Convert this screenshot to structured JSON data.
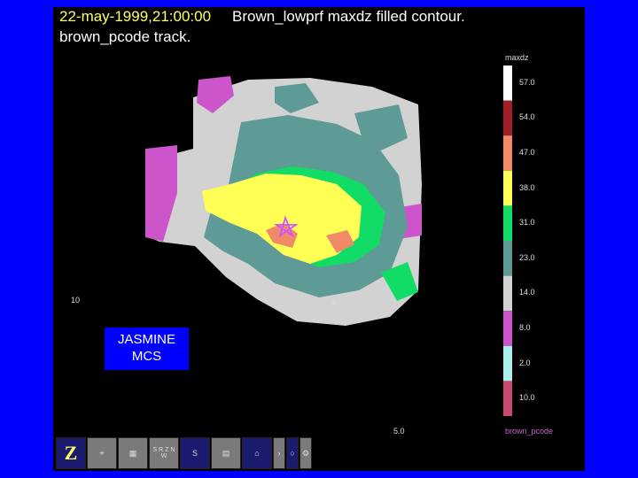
{
  "title": {
    "date": "22-may-1999,21:00:00",
    "main": "Brown_lowprf maxdz filled contour.",
    "sub": "brown_pcode track."
  },
  "axis": {
    "left_label": "10",
    "bottom_label": "5.0",
    "cross": "x"
  },
  "colorbar": {
    "title": "maxdz",
    "labels": [
      "57.0",
      "54.0",
      "47.0",
      "38.0",
      "31.0",
      "23.0",
      "14.0",
      "8.0",
      "2.0",
      "10.0"
    ],
    "colors": [
      "#ffffff",
      "#a0202a",
      "#f08a68",
      "#ffff55",
      "#11dd66",
      "#5e9a96",
      "#d2d2d2",
      "#cc55cc",
      "#aaeeee",
      "#c84a70"
    ],
    "footer": "brown_pcode"
  },
  "annotation": {
    "line1": "JASMINE",
    "line2": "MCS"
  },
  "toolbar": {
    "items": [
      "z-logo-icon",
      "radar-site-icon",
      "grid-icon",
      "s-r-z-nw-icon",
      "vertical-scale-icon",
      "table-icon",
      "station-icon",
      "arrow-icon",
      "circle-icon",
      "settings-icon"
    ],
    "labels": {
      "srz": "S R Z N W",
      "vert": "S"
    }
  }
}
